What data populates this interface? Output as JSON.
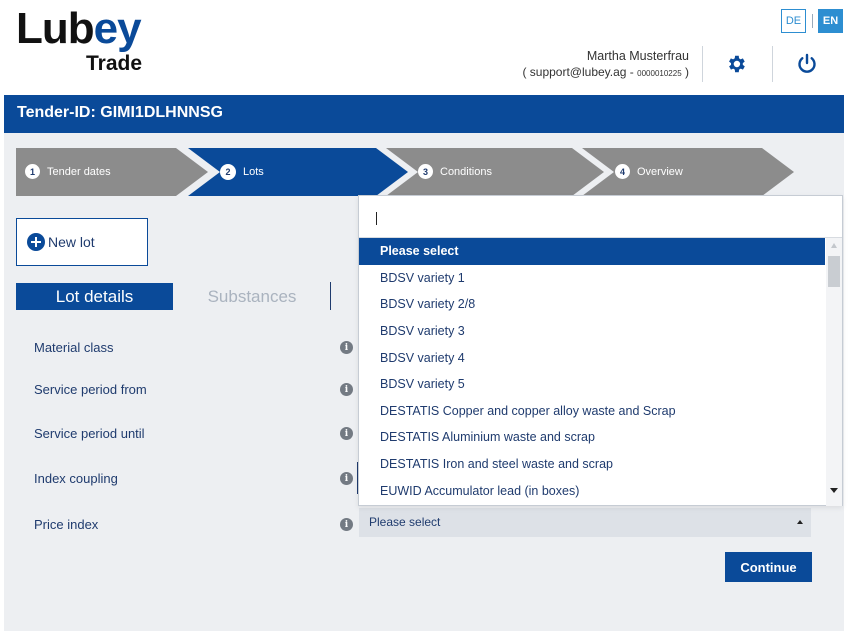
{
  "header": {
    "logo_main_a": "Lub",
    "logo_main_b": "ey",
    "logo_sub": "Trade",
    "lang_de": "DE",
    "lang_en": "EN",
    "user_name": "Martha Musterfrau",
    "user_email": "( support@lubey.ag -",
    "user_number": "0000010225",
    "user_close": ")",
    "icons": [
      "gear-icon",
      "power-icon"
    ]
  },
  "titlebar": {
    "text": "Tender-ID: GIMI1DLHNNSG"
  },
  "steps": [
    {
      "num": "1",
      "label": "Tender dates"
    },
    {
      "num": "2",
      "label": "Lots"
    },
    {
      "num": "3",
      "label": "Conditions"
    },
    {
      "num": "4",
      "label": "Overview"
    }
  ],
  "new_lot": {
    "label": "New lot"
  },
  "tabs": {
    "lot_details": "Lot details",
    "substances": "Substances"
  },
  "fields": {
    "material_class": "Material class",
    "service_from": "Service period from",
    "service_until": "Service period until",
    "index_coupling": "Index coupling",
    "price_index": "Price index"
  },
  "price_index_select": {
    "value": "Please select"
  },
  "dropdown": {
    "search_value": "",
    "options": [
      "Please select",
      "BDSV variety 1",
      "BDSV variety 2/8",
      "BDSV variety 3",
      "BDSV variety 4",
      "BDSV variety 5",
      "DESTATIS Copper and copper alloy waste and Scrap",
      "DESTATIS Aluminium waste and scrap",
      "DESTATIS Iron and steel waste and scrap",
      "EUWID Accumulator lead (in boxes)"
    ],
    "selected_index": 0
  },
  "continue": {
    "label": "Continue"
  },
  "colors": {
    "brand_blue": "#0a4a99",
    "step_grey": "#8c8c8c",
    "lang_blue": "#2d8ed1",
    "background": "#edeff2"
  }
}
